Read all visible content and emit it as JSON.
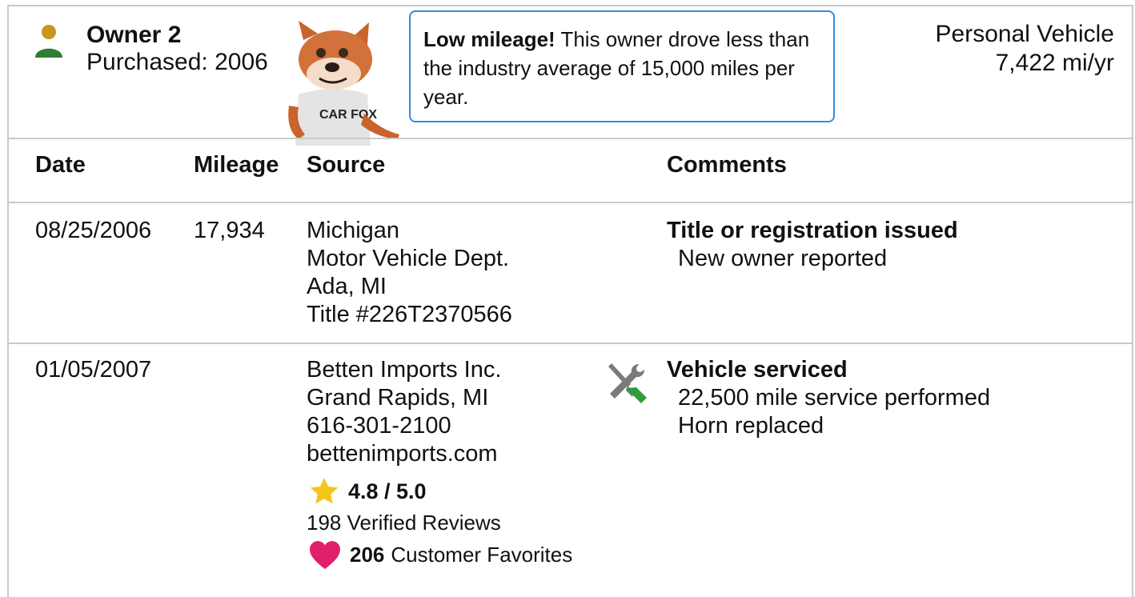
{
  "owner": {
    "name": "Owner 2",
    "purchased": "Purchased: 2006",
    "use_type": "Personal Vehicle",
    "miles_per_year": "7,422 mi/yr"
  },
  "callout": {
    "highlight": "Low mileage!",
    "text": " This owner drove less than the industry average of 15,000 miles per year."
  },
  "mascot": {
    "shirt_text": "CAR FOX"
  },
  "table": {
    "headers": {
      "date": "Date",
      "mileage": "Mileage",
      "source": "Source",
      "comments": "Comments"
    },
    "rows": [
      {
        "date": "08/25/2006",
        "mileage": "17,934",
        "source": [
          "Michigan",
          "Motor Vehicle Dept.",
          "Ada, MI",
          "Title #226T2370566"
        ],
        "comment_title": "Title or registration issued",
        "comment_lines": [
          "New owner reported"
        ]
      },
      {
        "date": "01/05/2007",
        "mileage": "",
        "source": [
          "Betten Imports Inc.",
          "Grand Rapids, MI",
          "616-301-2100",
          "bettenimports.com"
        ],
        "rating": "4.8 / 5.0",
        "reviews": "198 Verified Reviews",
        "favorites_count": "206",
        "favorites_label": "Customer Favorites",
        "comment_title": "Vehicle serviced",
        "comment_lines": [
          "22,500 mile service performed",
          "Horn replaced"
        ]
      }
    ]
  },
  "colors": {
    "owner_head": "#c9951c",
    "owner_body": "#2e7d32",
    "callout_border": "#3a8ad6",
    "star": "#f5c518",
    "heart": "#e0206a",
    "wrench_green": "#2e9e3a",
    "divider": "#c9c9c9"
  },
  "icons": [
    "owner-icon",
    "fox-mascot",
    "star-icon",
    "heart-icon",
    "service-wrench-icon"
  ]
}
